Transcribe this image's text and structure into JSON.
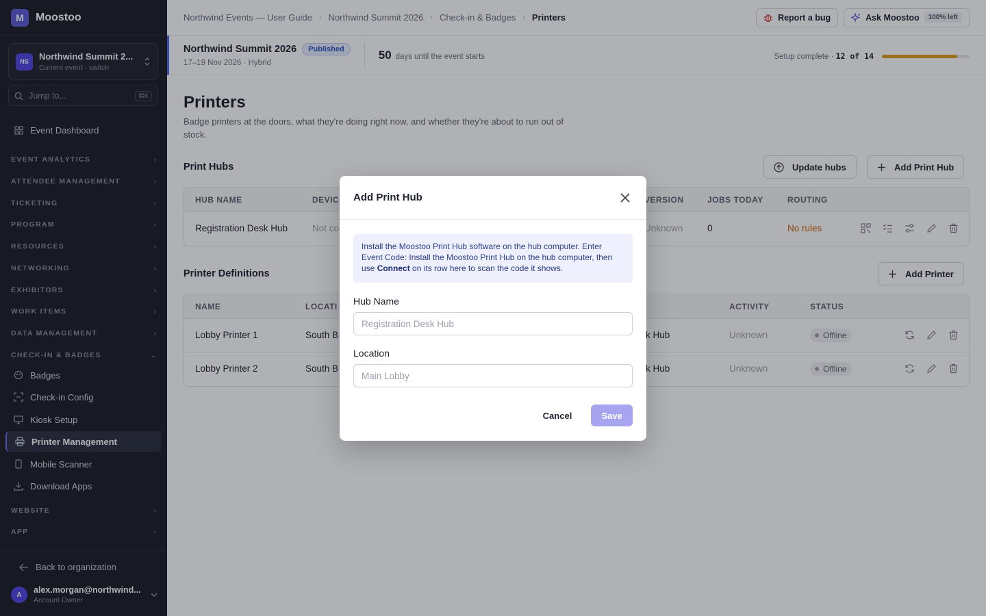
{
  "brand": {
    "logo_letter": "M",
    "name": "Moostoo"
  },
  "event_switcher": {
    "initials": "NS",
    "name": "Northwind Summit 2...",
    "subtitle": "Current event · switch"
  },
  "jump": {
    "placeholder": "Jump to...",
    "shortcut": "⌘K"
  },
  "sidebar": {
    "dashboard": "Event Dashboard",
    "sections": {
      "event_analytics": "EVENT ANALYTICS",
      "attendee_management": "ATTENDEE MANAGEMENT",
      "ticketing": "TICKETING",
      "program": "PROGRAM",
      "resources": "RESOURCES",
      "networking": "NETWORKING",
      "exhibitors": "EXHIBITORS",
      "work_items": "WORK ITEMS",
      "data_management": "DATA MANAGEMENT",
      "checkin_badges": "CHECK-IN & BADGES",
      "website": "WEBSITE",
      "app": "APP"
    },
    "checkin_items": {
      "badges": "Badges",
      "checkin_config": "Check-in Config",
      "kiosk_setup": "Kiosk Setup",
      "printer_management": "Printer Management",
      "mobile_scanner": "Mobile Scanner",
      "download_apps": "Download Apps"
    },
    "active_item": "Printer Management",
    "back_label": "Back to organization",
    "user": {
      "initial": "A",
      "email": "alex.morgan@northwind...",
      "role": "Account Owner"
    }
  },
  "breadcrumbs": [
    "Northwind Events — User Guide",
    "Northwind Summit 2026",
    "Check-in & Badges",
    "Printers"
  ],
  "topbar": {
    "report_bug": "Report a bug",
    "ask": "Ask Moostoo",
    "quota": "100% left"
  },
  "event_strip": {
    "name": "Northwind Summit 2026",
    "status": "Published",
    "dates": "17–19 Nov 2026 · Hybrid",
    "days_count": "50",
    "days_label": "days until the event starts",
    "setup_label": "Setup complete ·",
    "setup_count": "12 of 14",
    "setup_done": 12,
    "setup_total": 14
  },
  "page": {
    "title": "Printers",
    "description": "Badge printers at the doors, what they're doing right now, and whether they're about to run out of stock."
  },
  "print_hubs": {
    "title": "Print Hubs",
    "update_button": "Update hubs",
    "add_button": "Add Print Hub",
    "columns": [
      "HUB NAME",
      "DEVIC",
      "VERSION",
      "JOBS TODAY",
      "ROUTING"
    ],
    "rows": [
      {
        "name": "Registration Desk Hub",
        "device": "Not co",
        "version": "Unknown",
        "jobs_today": "0",
        "routing": "No rules"
      }
    ]
  },
  "printer_definitions": {
    "title": "Printer Definitions",
    "add_button": "Add Printer",
    "columns": [
      "NAME",
      "LOCATI",
      "ACTIVITY",
      "STATUS"
    ],
    "rows": [
      {
        "name": "Lobby Printer 1",
        "location": "South B",
        "hub": "k Hub",
        "activity": "Unknown",
        "status": "Offline"
      },
      {
        "name": "Lobby Printer 2",
        "location": "South B",
        "hub": "k Hub",
        "activity": "Unknown",
        "status": "Offline"
      }
    ]
  },
  "modal": {
    "title": "Add Print Hub",
    "info_before": "Install the Moostoo Print Hub software on the hub computer. Enter Event Code: Install the Moostoo Print Hub on the hub computer, then use ",
    "info_bold": "Connect",
    "info_after": " on its row here to scan the code it shows.",
    "hub_name_label": "Hub Name",
    "hub_name_placeholder": "Registration Desk Hub",
    "location_label": "Location",
    "location_placeholder": "Main Lobby",
    "cancel": "Cancel",
    "save": "Save"
  },
  "colors": {
    "accent": "#5b5bd6",
    "progress": "#e0a11b",
    "warning": "#c2630a",
    "save_disabled": "#a9a4f0"
  }
}
